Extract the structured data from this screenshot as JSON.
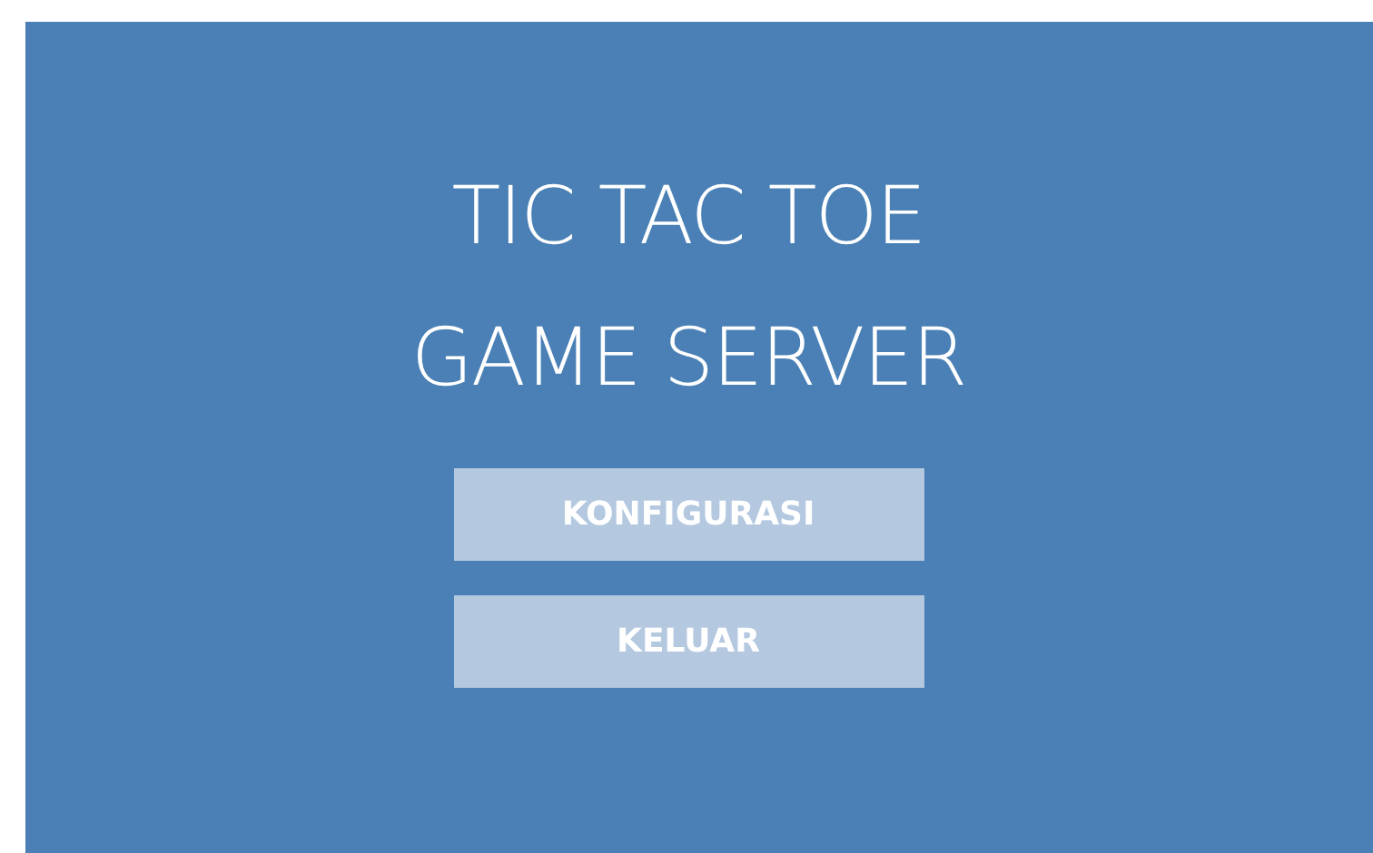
{
  "title_lines": [
    "TIC TAC TOE",
    "GAME SERVER"
  ],
  "buttons": [
    "KONFIGURASI",
    "KELUAR"
  ]
}
